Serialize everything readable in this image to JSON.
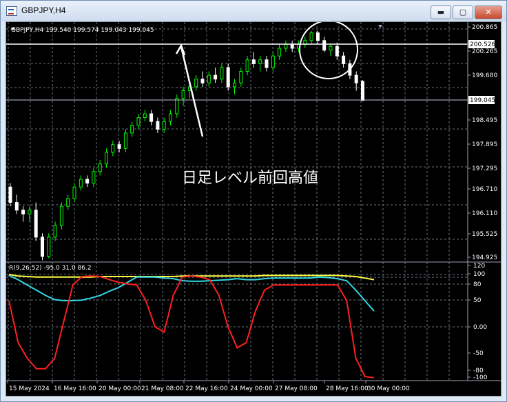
{
  "window": {
    "title": "GBPJPY,H4",
    "buttons": {
      "minimize": "▬",
      "maximize": "▢",
      "close": "✕"
    }
  },
  "chart": {
    "info": "GBPJPY,H4  199.540 199.574 199.043 199.045",
    "price_ticks": [
      "200.865",
      "200.265",
      "199.680",
      "198.495",
      "197.895",
      "197.295",
      "196.710",
      "196.110",
      "195.525",
      "194.925"
    ],
    "price_marker_top": "200.526",
    "price_marker_current": "199.045",
    "annotation": "日足レベル前回高値",
    "candle_up_color": "#00ff00",
    "candle_down_color": "#ffffff"
  },
  "indicator": {
    "label": "R(9,26,52) -95.0 31.0 86.2",
    "ticks": [
      "120",
      "100",
      "80",
      "50",
      "0.00",
      "-50",
      "-80",
      "-100"
    ],
    "line_colors": {
      "short": "#ff2020",
      "medium": "#30d8e8",
      "long": "#ffff40"
    }
  },
  "time_axis": [
    "15 May 2024",
    "16 May 16:00",
    "20 May 00:00",
    "21 May 08:00",
    "22 May 16:00",
    "24 May 00:00",
    "27 May 08:00",
    "28 May 16:00",
    "30 May 00:00"
  ]
}
